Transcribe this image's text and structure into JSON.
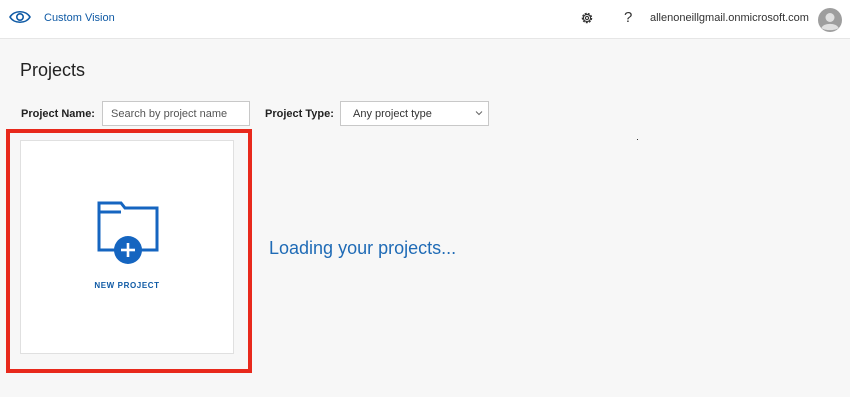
{
  "app": {
    "title": "Custom Vision"
  },
  "header": {
    "account_name": "allenoneillgmail.onmicrosoft.com",
    "help_label": "?"
  },
  "page": {
    "title": "Projects"
  },
  "filters": {
    "name_label": "Project Name:",
    "name_placeholder": "Search by project name",
    "type_label": "Project Type:",
    "type_value": "Any project type"
  },
  "new_project": {
    "label": "NEW PROJECT"
  },
  "status": {
    "loading_text": "Loading your projects..."
  },
  "colors": {
    "brand": "#0f5aa5",
    "highlight": "#e8291c",
    "folder_blue": "#1565c0",
    "loading_text": "#1f6bb6"
  },
  "icons": [
    "eye-icon",
    "gear-icon",
    "help-icon",
    "avatar-icon",
    "chevron-down-icon",
    "folder-add-icon"
  ]
}
